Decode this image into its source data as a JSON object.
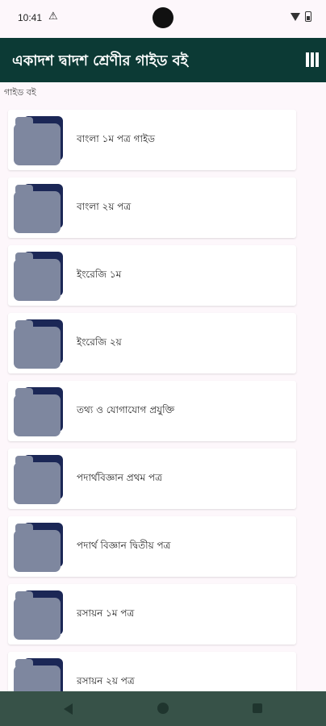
{
  "status_bar": {
    "time": "10:41",
    "alert_glyph": "⚠"
  },
  "app_bar": {
    "title": "একাদশ দ্বাদশ শ্রেণীর গাইড বই",
    "menu_icon": "menu-bars-icon"
  },
  "section_label": "গাইড বই",
  "colors": {
    "app_bar": "#0c3a35",
    "background": "#fdf7fb",
    "folder_body": "#7e879f",
    "folder_tab": "#1b2756",
    "nav_bar": "#375248"
  },
  "items": [
    {
      "label": "বাংলা ১ম পত্র  গাইড"
    },
    {
      "label": "বাংলা ২য় পত্র"
    },
    {
      "label": "ইংরেজি ১ম"
    },
    {
      "label": "ইংরেজি ২য়"
    },
    {
      "label": "তথ্য ও যোগাযোগ প্রযুক্তি"
    },
    {
      "label": "পদার্থবিজ্ঞান প্রথম পত্র"
    },
    {
      "label": "পদার্থ বিজ্ঞান দ্বিতীয় পত্র"
    },
    {
      "label": "রসায়ন ১ম পত্র"
    },
    {
      "label": "রসায়ন ২য় পত্র"
    }
  ]
}
